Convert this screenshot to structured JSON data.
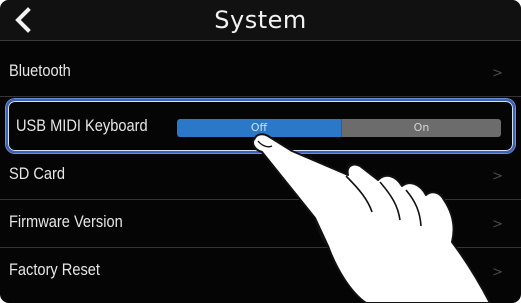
{
  "header": {
    "title": "System",
    "back_icon": "chevron-left-icon"
  },
  "menu": {
    "items": [
      {
        "label": "Bluetooth",
        "chevron": ">"
      },
      {
        "label": "USB MIDI Keyboard"
      },
      {
        "label": "SD Card",
        "chevron": ">"
      },
      {
        "label": "Firmware Version",
        "chevron": ">"
      },
      {
        "label": "Factory Reset",
        "chevron": ">"
      }
    ]
  },
  "usb_midi_keyboard": {
    "options": [
      "Off",
      "On"
    ],
    "selected": "Off"
  },
  "colors": {
    "selected_segment": "#2b78c8",
    "unselected_segment": "#6c6c6c",
    "highlight_border": "#3b64b8"
  }
}
